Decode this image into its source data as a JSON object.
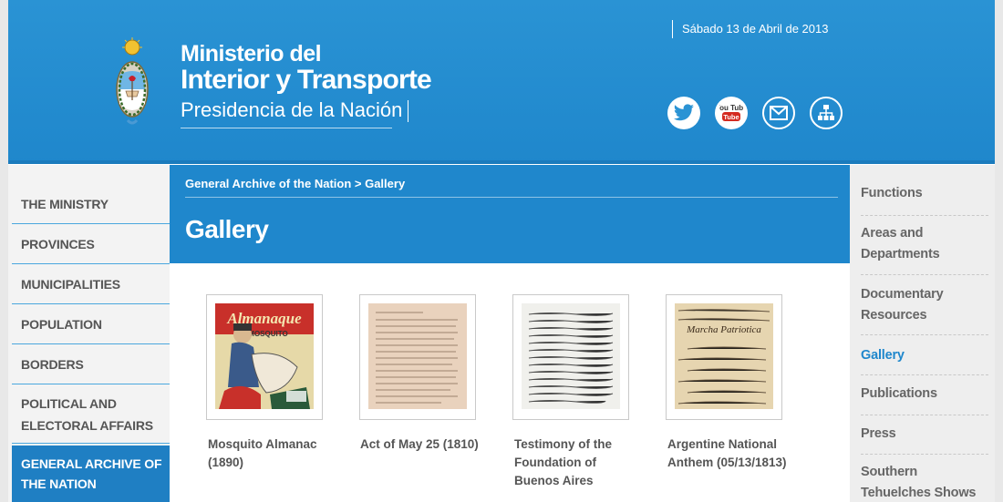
{
  "header": {
    "brand_line1": "Ministerio del",
    "brand_line2": "Interior y Transporte",
    "brand_line3": "Presidencia de la Nación",
    "date": "Sábado 13 de Abril de 2013",
    "social": [
      {
        "icon": "twitter-icon"
      },
      {
        "icon": "youtube-icon",
        "text": "You Tube"
      },
      {
        "icon": "mail-icon"
      },
      {
        "icon": "sitemap-icon"
      }
    ]
  },
  "left_nav": {
    "items": [
      {
        "label": "THE MINISTRY"
      },
      {
        "label": "PROVINCES"
      },
      {
        "label": "MUNICIPALITIES"
      },
      {
        "label": "POPULATION"
      },
      {
        "label": "BORDERS"
      },
      {
        "label": "POLITICAL AND ELECTORAL AFFAIRS"
      },
      {
        "label": "GENERAL ARCHIVE OF THE NATION",
        "active": true
      }
    ]
  },
  "main": {
    "breadcrumb": "General Archive of the Nation > Gallery",
    "title": "Gallery",
    "gallery": [
      {
        "caption": "Mosquito Almanac (1890)",
        "thumb_text_top": "Almanaque",
        "thumb_text_sub": "MOSQUITO"
      },
      {
        "caption": "Act of May 25 (1810)"
      },
      {
        "caption": "Testimony of the Foundation of Buenos Aires"
      },
      {
        "caption": "Argentine National Anthem (05/13/1813)",
        "thumb_text_top": "Marcha Patriotica"
      }
    ]
  },
  "right_nav": {
    "items": [
      {
        "label": "Functions"
      },
      {
        "label": "Areas and Departments"
      },
      {
        "label": "Documentary Resources"
      },
      {
        "label": "Gallery",
        "active": true
      },
      {
        "label": "Publications"
      },
      {
        "label": "Press"
      },
      {
        "label": "Southern Tehuelches Shows"
      }
    ]
  },
  "colors": {
    "header_blue": "#2a93d4",
    "nav_active": "#1f7fc3",
    "accent": "#1f87cc"
  }
}
